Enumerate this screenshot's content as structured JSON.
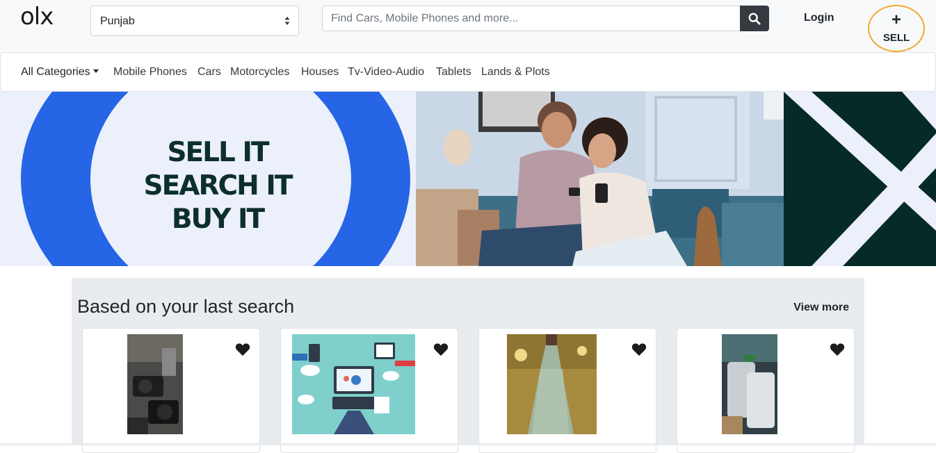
{
  "header": {
    "logo": "olx",
    "location_value": "Punjab",
    "search_placeholder": "Find Cars, Mobile Phones and more...",
    "login_label": "Login",
    "sell_plus": "+",
    "sell_label": "SELL"
  },
  "categories": {
    "all_label": "All Categories",
    "items": [
      "Mobile Phones",
      "Cars",
      "Motorcycles",
      "Houses",
      "Tv-Video-Audio",
      "Tablets",
      "Lands & Plots"
    ]
  },
  "banner": {
    "slogan": [
      "SELL IT",
      "SEARCH IT",
      "BUY IT"
    ]
  },
  "recommendations": {
    "title": "Based on your last search",
    "view_more": "View more",
    "cards": [
      {
        "image": "camera-photo",
        "favorite_icon": "heart-icon"
      },
      {
        "image": "computer-illustration",
        "favorite_icon": "heart-icon"
      },
      {
        "image": "dress-photo",
        "favorite_icon": "heart-icon"
      },
      {
        "image": "phones-photo",
        "favorite_icon": "heart-icon"
      }
    ]
  },
  "colors": {
    "accent": "#f0a92d",
    "brand_dark": "#0d2f2c",
    "banner_blue": "#2565e6",
    "search_button": "#343a40"
  }
}
